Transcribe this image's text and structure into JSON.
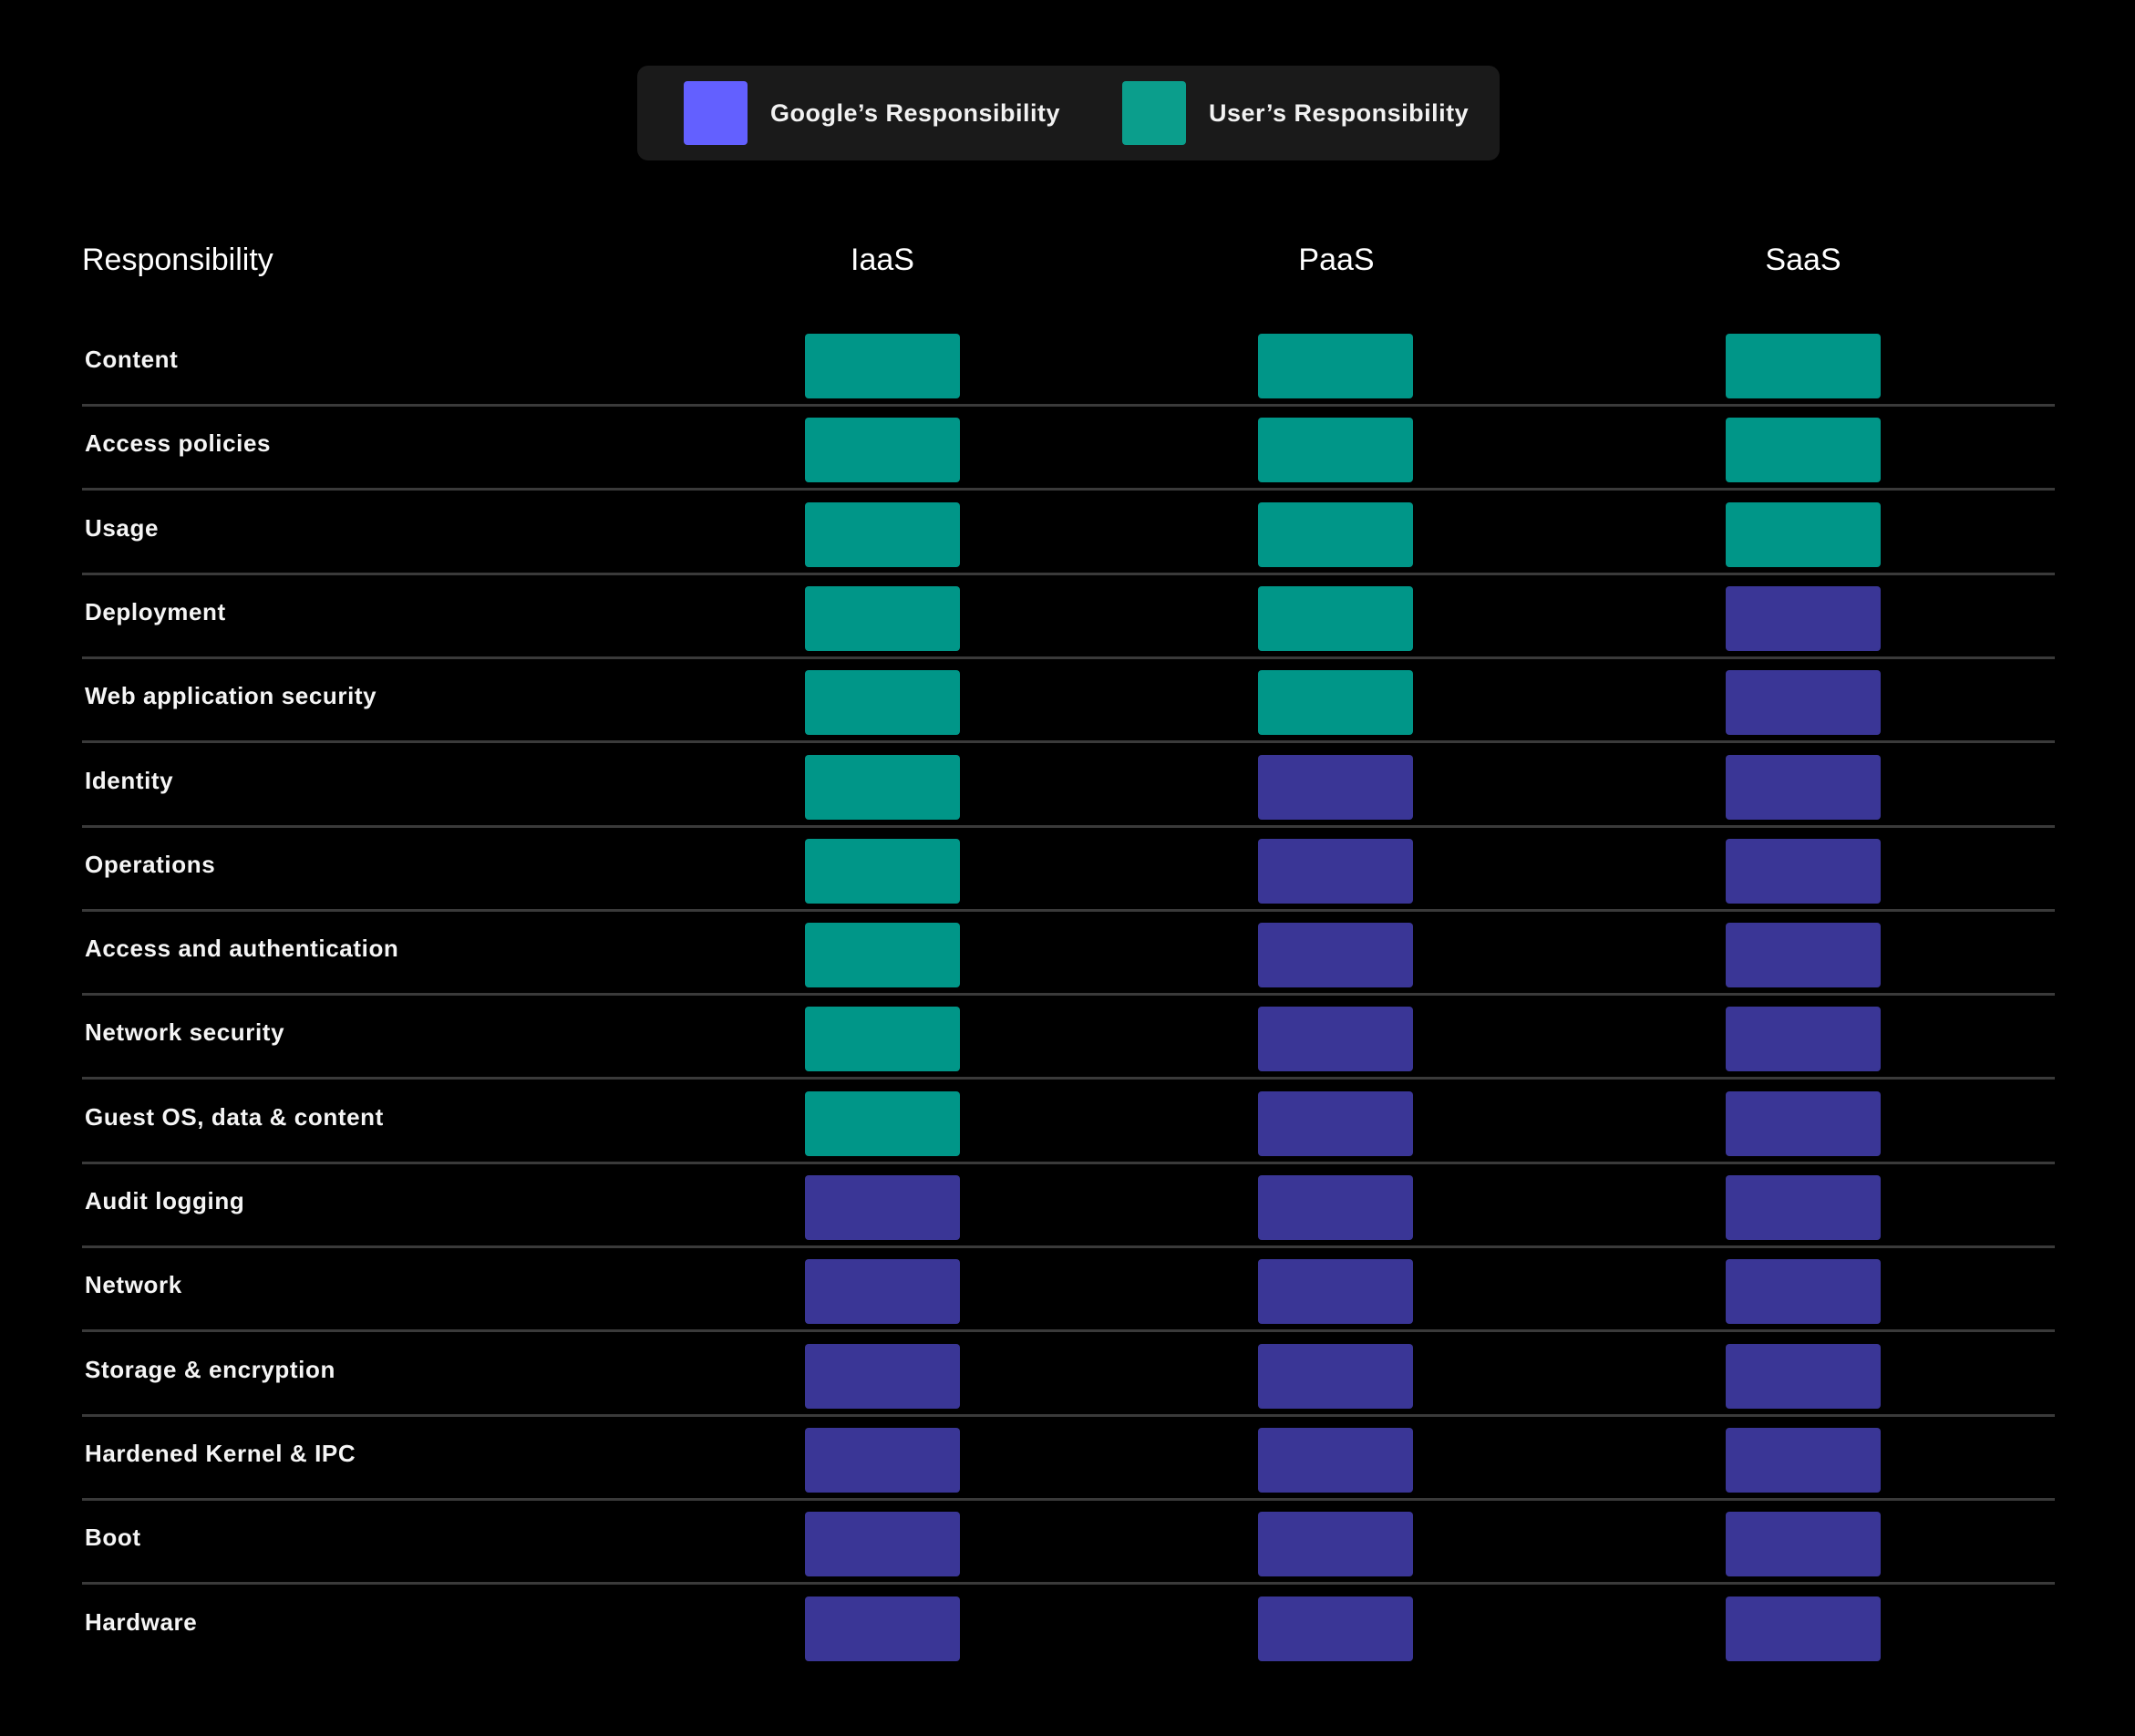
{
  "legend": {
    "google": {
      "label": "Google’s Responsibility",
      "color": "#6360ff"
    },
    "user": {
      "label": "User’s Responsibility",
      "color": "#0b9e8c"
    }
  },
  "colors": {
    "G": "#3a3696",
    "U": "#009688"
  },
  "table": {
    "header": "Responsibility",
    "columns": [
      "IaaS",
      "PaaS",
      "SaaS"
    ],
    "rows": [
      {
        "label": "Content",
        "cells": [
          "U",
          "U",
          "U"
        ]
      },
      {
        "label": "Access policies",
        "cells": [
          "U",
          "U",
          "U"
        ]
      },
      {
        "label": "Usage",
        "cells": [
          "U",
          "U",
          "U"
        ]
      },
      {
        "label": "Deployment",
        "cells": [
          "U",
          "U",
          "G"
        ]
      },
      {
        "label": "Web application security",
        "cells": [
          "U",
          "U",
          "G"
        ]
      },
      {
        "label": "Identity",
        "cells": [
          "U",
          "G",
          "G"
        ]
      },
      {
        "label": "Operations",
        "cells": [
          "U",
          "G",
          "G"
        ]
      },
      {
        "label": "Access and authentication",
        "cells": [
          "U",
          "G",
          "G"
        ]
      },
      {
        "label": "Network security",
        "cells": [
          "U",
          "G",
          "G"
        ]
      },
      {
        "label": "Guest OS, data & content",
        "cells": [
          "U",
          "G",
          "G"
        ]
      },
      {
        "label": "Audit logging",
        "cells": [
          "G",
          "G",
          "G"
        ]
      },
      {
        "label": "Network",
        "cells": [
          "G",
          "G",
          "G"
        ]
      },
      {
        "label": "Storage & encryption",
        "cells": [
          "G",
          "G",
          "G"
        ]
      },
      {
        "label": "Hardened Kernel & IPC",
        "cells": [
          "G",
          "G",
          "G"
        ]
      },
      {
        "label": "Boot",
        "cells": [
          "G",
          "G",
          "G"
        ]
      },
      {
        "label": "Hardware",
        "cells": [
          "G",
          "G",
          "G"
        ]
      }
    ]
  }
}
